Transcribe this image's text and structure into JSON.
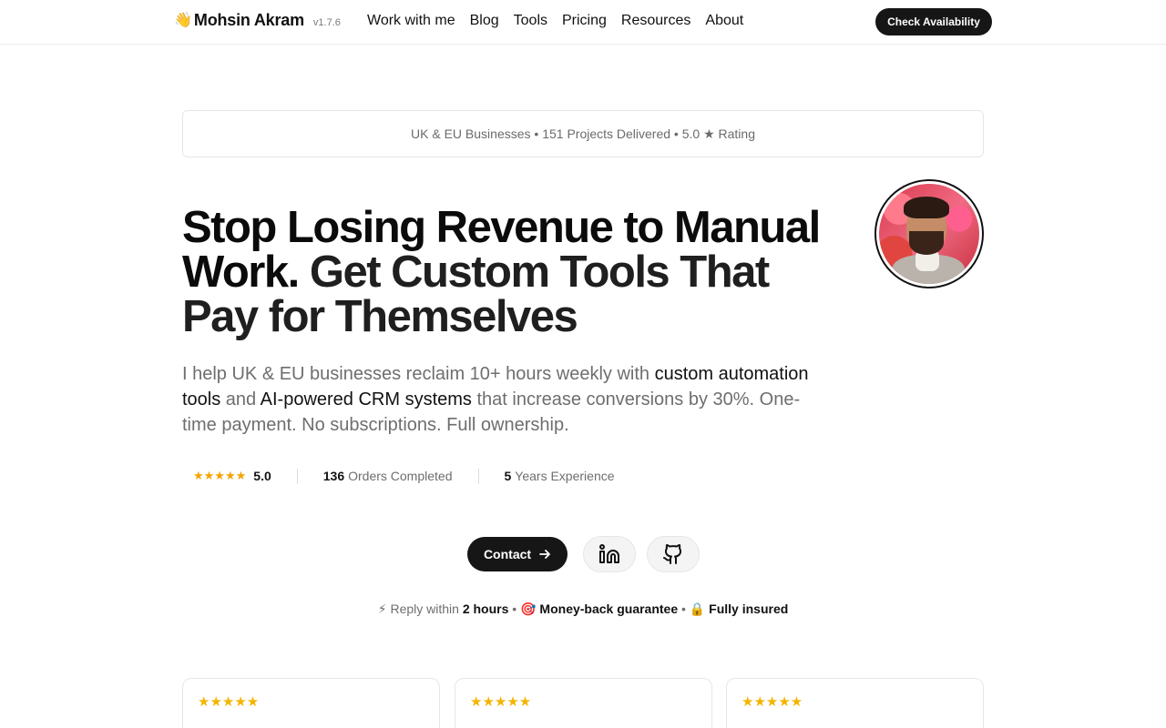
{
  "header": {
    "brand_emoji": "👋",
    "brand_name": "Mohsin Akram",
    "version": "v1.7.6",
    "nav": [
      "Work with me",
      "Blog",
      "Tools",
      "Pricing",
      "Resources",
      "About"
    ],
    "cta": "Check Availability"
  },
  "trust_strip": "UK & EU Businesses • 151 Projects Delivered • 5.0 ★ Rating",
  "hero": {
    "title_main": "Stop Losing Revenue to Manual Work.",
    "title_accent": "Get Custom Tools That Pay for Themselves",
    "lead_1": "I help UK & EU businesses reclaim 10+ hours weekly with ",
    "lead_strong_1": "custom automation tools",
    "lead_2": " and ",
    "lead_strong_2": "AI-powered CRM systems",
    "lead_3": " that increase conversions by 30%. One-time payment. No subscriptions. Full ownership."
  },
  "stats": {
    "stars": "★★★★★",
    "rating": "5.0",
    "orders_value": "136",
    "orders_label": "Orders Completed",
    "years_value": "5",
    "years_label": "Years Experience"
  },
  "actions": {
    "contact": "Contact"
  },
  "guarantee": {
    "icon_1": "⚡",
    "text_1": "Reply within",
    "bold_1": "2 hours",
    "sep": "•",
    "icon_2": "🎯",
    "bold_2": "Money-back guarantee",
    "icon_3": "🔒",
    "bold_3": "Fully insured"
  },
  "reviews": [
    {
      "stars": "★★★★★"
    },
    {
      "stars": "★★★★★"
    },
    {
      "stars": "★★★★★"
    }
  ],
  "colors": {
    "primary_dark": "#161616",
    "star": "#f4a300",
    "muted_text": "#6e6e6e"
  }
}
